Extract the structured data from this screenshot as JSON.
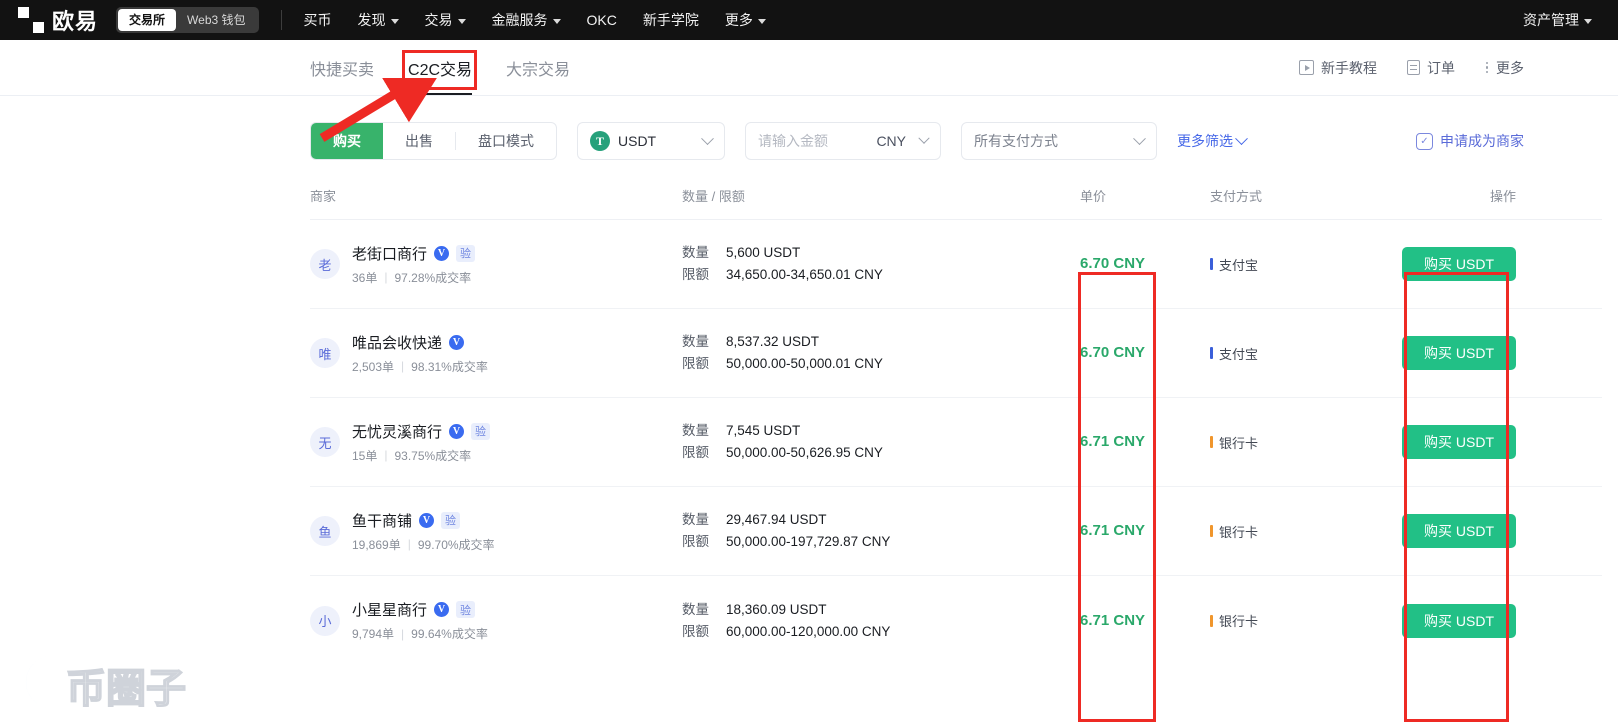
{
  "topnav": {
    "brand_name": "欧易",
    "segments": [
      {
        "label": "交易所",
        "active": true
      },
      {
        "label": "Web3 钱包",
        "active": false
      }
    ],
    "links": [
      {
        "label": "买币",
        "caret": false
      },
      {
        "label": "发现",
        "caret": true
      },
      {
        "label": "交易",
        "caret": true
      },
      {
        "label": "金融服务",
        "caret": true
      },
      {
        "label": "OKC",
        "caret": false
      },
      {
        "label": "新手学院",
        "caret": false
      },
      {
        "label": "更多",
        "caret": true
      }
    ],
    "right": {
      "label": "资产管理",
      "caret": true
    }
  },
  "subnav": {
    "tabs": [
      {
        "label": "快捷买卖",
        "active": false
      },
      {
        "label": "C2C交易",
        "active": true
      },
      {
        "label": "大宗交易",
        "active": false
      }
    ],
    "right_links": [
      {
        "label": "新手教程",
        "icon": "play-box-icon"
      },
      {
        "label": "订单",
        "icon": "document-icon"
      },
      {
        "label": "更多",
        "icon": "vertical-dots-icon"
      }
    ]
  },
  "filters": {
    "side_buttons": [
      {
        "label": "购买",
        "active": true
      },
      {
        "label": "出售",
        "active": false
      },
      {
        "label": "盘口模式",
        "active": false
      }
    ],
    "coin": {
      "value": "USDT",
      "logo_text": "T",
      "logo_color": "#26A17B"
    },
    "amount": {
      "placeholder": "请输入金额",
      "value": "",
      "currency": "CNY"
    },
    "payment": {
      "value": "所有支付方式"
    },
    "more_filters": "更多筛选",
    "merchant_apply": "申请成为商家"
  },
  "table": {
    "headers": {
      "merchant": "商家",
      "amount": "数量 / 限额",
      "price": "单价",
      "payment": "支付方式",
      "action": "操作"
    },
    "labels": {
      "qty": "数量",
      "limit": "限额"
    },
    "buy_button": "购买 USDT",
    "rows": [
      {
        "avatar": "老",
        "name": "老街口商行",
        "verified": true,
        "certified": true,
        "orders": "36单",
        "completion": "97.28%成交率",
        "qty": "5,600 USDT",
        "limit": "34,650.00-34,650.01 CNY",
        "price": "6.70 CNY",
        "payment": "支付宝",
        "payment_color": "#3a5fd9"
      },
      {
        "avatar": "唯",
        "name": "唯品会收快递",
        "verified": true,
        "certified": false,
        "orders": "2,503单",
        "completion": "98.31%成交率",
        "qty": "8,537.32 USDT",
        "limit": "50,000.00-50,000.01 CNY",
        "price": "6.70 CNY",
        "payment": "支付宝",
        "payment_color": "#3a5fd9"
      },
      {
        "avatar": "无",
        "name": "无忧灵溪商行",
        "verified": true,
        "certified": true,
        "orders": "15单",
        "completion": "93.75%成交率",
        "qty": "7,545 USDT",
        "limit": "50,000.00-50,626.95 CNY",
        "price": "6.71 CNY",
        "payment": "银行卡",
        "payment_color": "#f0962c"
      },
      {
        "avatar": "鱼",
        "name": "鱼干商铺",
        "verified": true,
        "certified": true,
        "orders": "19,869单",
        "completion": "99.70%成交率",
        "qty": "29,467.94 USDT",
        "limit": "50,000.00-197,729.87 CNY",
        "price": "6.71 CNY",
        "payment": "银行卡",
        "payment_color": "#f0962c"
      },
      {
        "avatar": "小",
        "name": "小星星商行",
        "verified": true,
        "certified": true,
        "orders": "9,794单",
        "completion": "99.64%成交率",
        "qty": "18,360.09 USDT",
        "limit": "60,000.00-120,000.00 CNY",
        "price": "6.71 CNY",
        "payment": "银行卡",
        "payment_color": "#f0962c"
      }
    ]
  },
  "badges": {
    "verified_text": "V",
    "certified_text": "验"
  },
  "watermark": {
    "text": "币圈子"
  },
  "colors": {
    "accent_green": "#22c086",
    "price_green": "#2aa86a",
    "annotation_red": "#ee2a24",
    "link_blue": "#4567e8",
    "nav_dark": "#121212"
  }
}
